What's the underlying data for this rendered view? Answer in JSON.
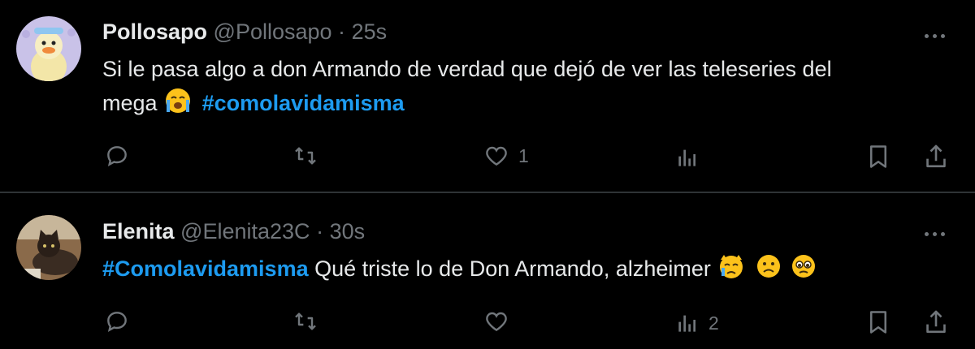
{
  "tweets": [
    {
      "display_name": "Pollosapo",
      "handle": "@Pollosapo",
      "separator": "·",
      "time": "25s",
      "text_line1": "Si le pasa algo a don Armando de verdad que dejó de ver las teleseries del",
      "text_line2": "mega",
      "hashtag": "#comolavidamisma",
      "like_count": "1",
      "views_count": ""
    },
    {
      "display_name": "Elenita",
      "handle": "@Elenita23C",
      "separator": "·",
      "time": "30s",
      "hashtag": "#Comolavidamisma",
      "text": "Qué triste lo de Don Armando, alzheimer",
      "like_count": "",
      "views_count": "2"
    }
  ],
  "icons": [
    "more-icon",
    "reply-icon",
    "retweet-icon",
    "like-icon",
    "views-icon",
    "bookmark-icon",
    "share-icon"
  ],
  "colors": {
    "background": "#000000",
    "text": "#e7e9ea",
    "muted": "#71767b",
    "link": "#1d9bf0",
    "divider": "#2f3336"
  }
}
